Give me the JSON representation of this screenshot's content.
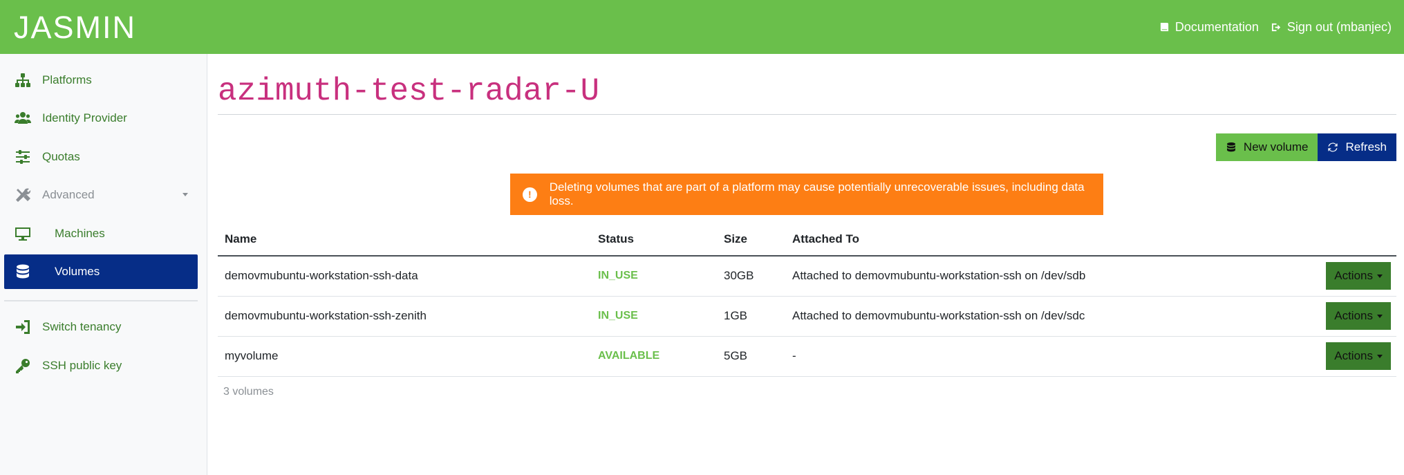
{
  "topbar": {
    "brand": "JASMIN",
    "links": {
      "documentation": "Documentation",
      "signout": "Sign out (mbanjec)"
    }
  },
  "sidebar": {
    "items": [
      {
        "label": "Platforms",
        "icon": "sitemap-icon"
      },
      {
        "label": "Identity Provider",
        "icon": "users-icon"
      },
      {
        "label": "Quotas",
        "icon": "sliders-icon"
      },
      {
        "label": "Advanced",
        "icon": "tools-icon"
      },
      {
        "label": "Machines",
        "icon": "desktop-icon"
      },
      {
        "label": "Volumes",
        "icon": "database-icon",
        "active": true
      },
      {
        "label": "Switch tenancy",
        "icon": "sign-in-icon"
      },
      {
        "label": "SSH public key",
        "icon": "key-icon"
      }
    ]
  },
  "main": {
    "title": "azimuth-test-radar-U",
    "buttons": {
      "new_volume": "New volume",
      "refresh": "Refresh"
    },
    "alert": "Deleting volumes that are part of a platform may cause potentially unrecoverable issues, including data loss.",
    "table": {
      "headers": [
        "Name",
        "Status",
        "Size",
        "Attached To"
      ],
      "rows": [
        {
          "name": "demovmubuntu-workstation-ssh-data",
          "status": "IN_USE",
          "size": "30GB",
          "attached": "Attached to demovmubuntu-workstation-ssh on /dev/sdb",
          "action": "Actions"
        },
        {
          "name": "demovmubuntu-workstation-ssh-zenith",
          "status": "IN_USE",
          "size": "1GB",
          "attached": "Attached to demovmubuntu-workstation-ssh on /dev/sdc",
          "action": "Actions"
        },
        {
          "name": "myvolume",
          "status": "AVAILABLE",
          "size": "5GB",
          "attached": "-",
          "action": "Actions"
        }
      ]
    },
    "count": "3 volumes"
  },
  "colors": {
    "brand_green": "#6abf4b",
    "dark_green": "#3a7d2c",
    "navy": "#062d87",
    "warning_orange": "#fd7e14",
    "title_magenta": "#c8307e",
    "annotation_red": "#d32f2f"
  }
}
